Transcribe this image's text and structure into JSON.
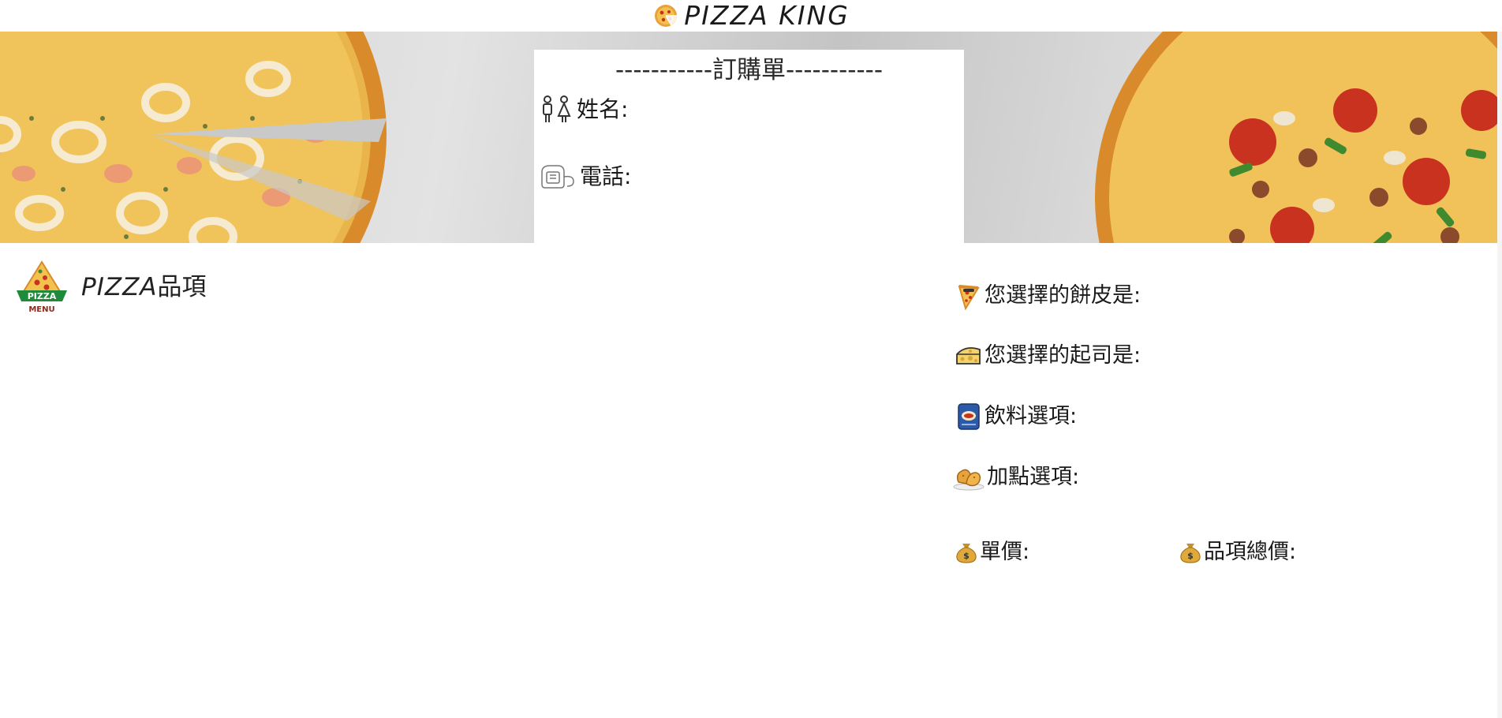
{
  "header": {
    "brand": "PIZZA KING",
    "logo_icon": "pizza-slices-icon"
  },
  "order_form": {
    "title": "-----------訂購單-----------",
    "name_label": "姓名:",
    "name_value": "",
    "phone_label": "電話:",
    "phone_value": "",
    "name_icon": "man-woman-icon",
    "phone_icon": "telephone-icon"
  },
  "menu": {
    "title_latin": "PIZZA",
    "title_cjk": "品項",
    "logo_caption_top": "PIZZA",
    "logo_caption_bottom": "MENU",
    "items": []
  },
  "summary": {
    "crust_label": "您選擇的餅皮是:",
    "cheese_label": "您選擇的起司是:",
    "drink_label": "飲料選項:",
    "extra_label": "加點選項:",
    "unit_price_label": "單價:",
    "total_price_label": "品項總價:",
    "crust_value": "",
    "cheese_value": "",
    "drink_value": "",
    "extra_value": "",
    "unit_price_value": "",
    "total_price_value": "",
    "icons": {
      "crust": "pizza-slice-icon",
      "cheese": "cheese-icon",
      "drink": "drink-can-icon",
      "extra": "fried-chicken-icon",
      "money": "money-bag-icon"
    }
  },
  "colors": {
    "pizza_crust": "#d98a2b",
    "cheese": "#f2c14e",
    "sauce_red": "#c8321e",
    "menu_green": "#1f8a3a",
    "money_gold": "#e0a93b"
  }
}
